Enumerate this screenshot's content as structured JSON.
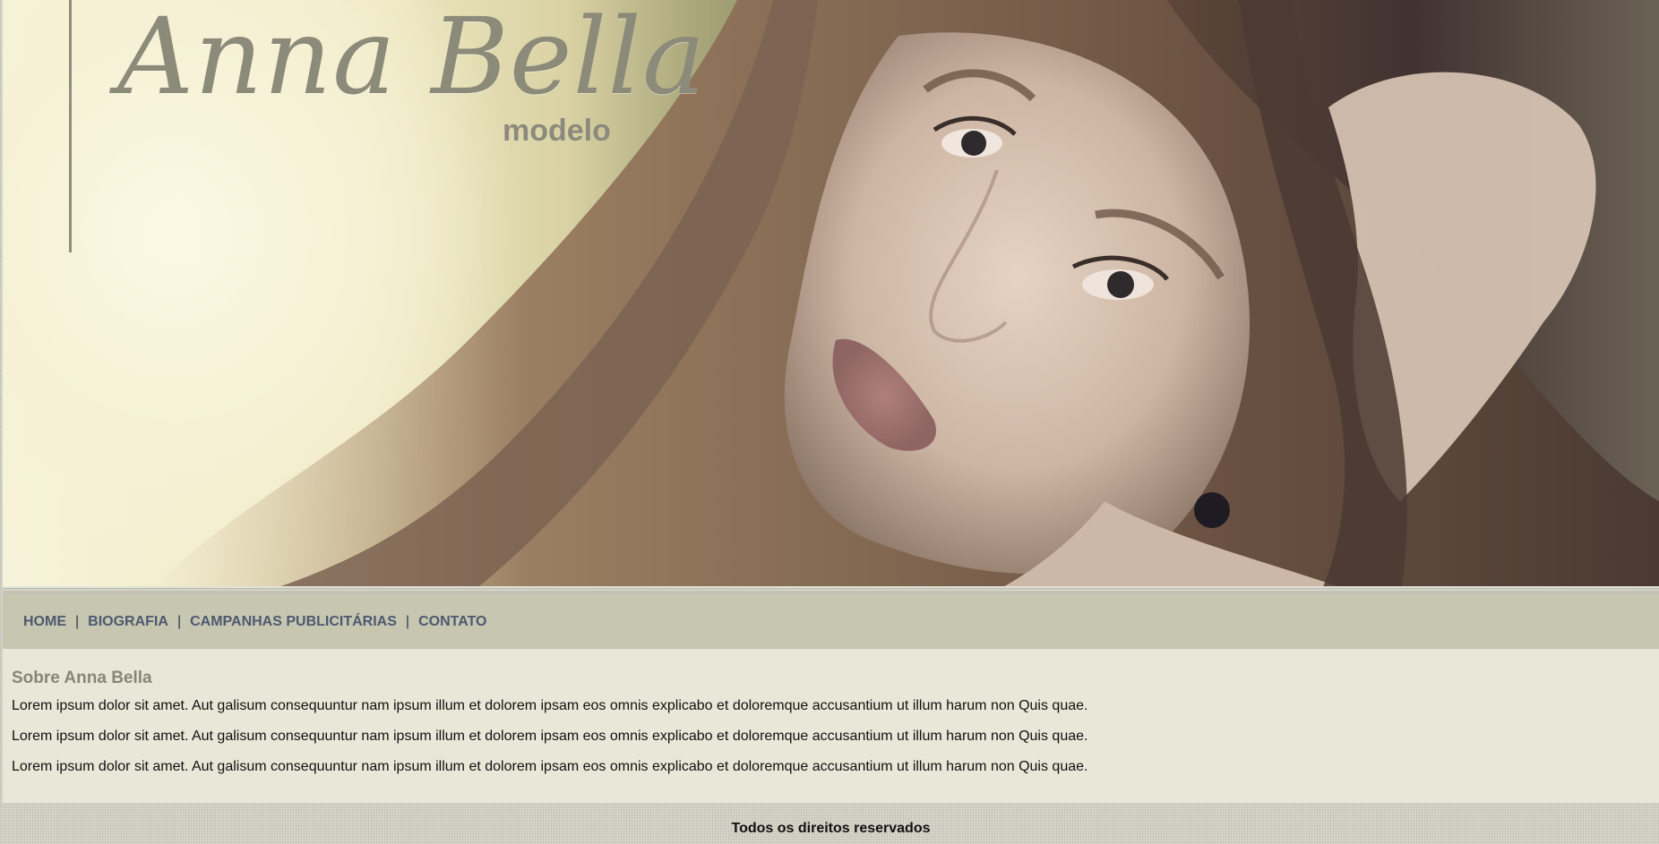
{
  "header": {
    "logo_script": "Anna Bella",
    "logo_sub": "modelo",
    "hero_image": "model-portrait-photo"
  },
  "nav": {
    "items": [
      {
        "label": "HOME"
      },
      {
        "label": "BIOGRAFIA"
      },
      {
        "label": "CAMPANHAS PUBLICITÁRIAS"
      },
      {
        "label": "CONTATO"
      }
    ],
    "separator": "|"
  },
  "main": {
    "title": "Sobre Anna Bella",
    "paragraphs": [
      "Lorem ipsum dolor sit amet. Aut galisum consequuntur nam ipsum illum et dolorem ipsam eos omnis explicabo et doloremque accusantium ut illum harum non Quis quae.",
      "Lorem ipsum dolor sit amet. Aut galisum consequuntur nam ipsum illum et dolorem ipsam eos omnis explicabo et doloremque accusantium ut illum harum non Quis quae.",
      "Lorem ipsum dolor sit amet. Aut galisum consequuntur nam ipsum illum et dolorem ipsam eos omnis explicabo et doloremque accusantium ut illum harum non Quis quae."
    ]
  },
  "footer": {
    "text": "Todos os direitos reservados"
  },
  "colors": {
    "nav_bg": "#c6c6b1",
    "nav_link": "#4d5970",
    "content_bg": "#e8e8d8",
    "heading": "#878677",
    "logo": "#8c8a78"
  }
}
